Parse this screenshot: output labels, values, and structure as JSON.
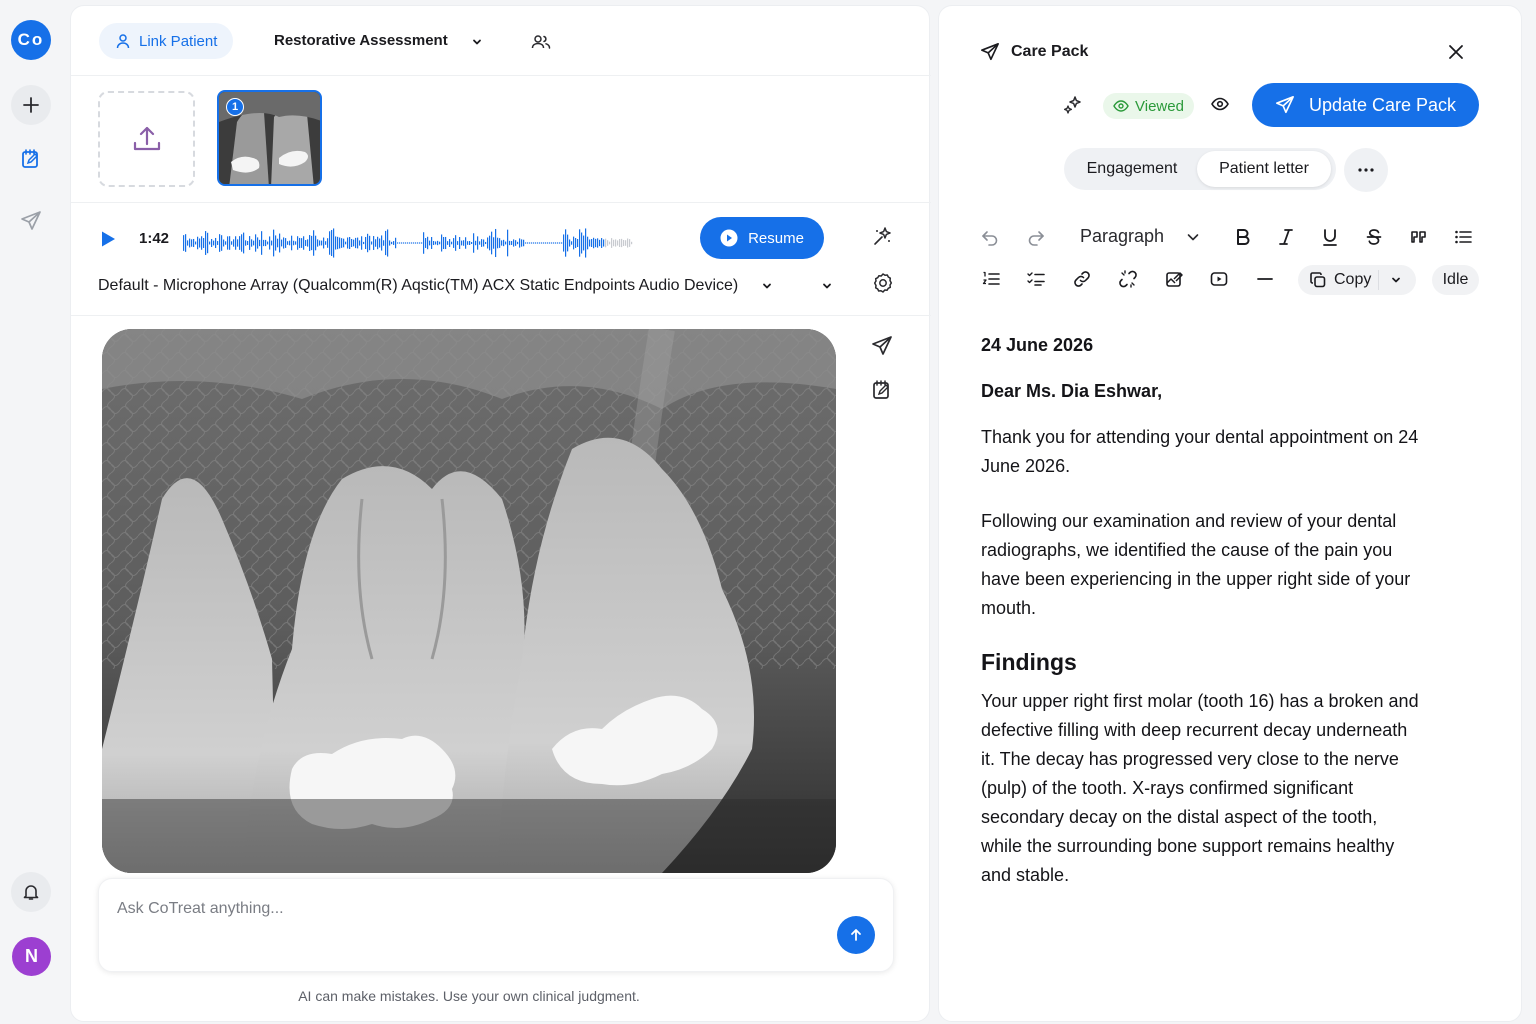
{
  "app": {
    "logo_text": "Co",
    "avatar_initial": "N",
    "accent_color": "#1670e8"
  },
  "header": {
    "link_patient_label": "Link Patient",
    "assessment_label": "Restorative Assessment"
  },
  "images": {
    "thumbnail_badge": "1"
  },
  "recording": {
    "time": "1:42",
    "resume_label": "Resume",
    "device_label": "Default - Microphone Array (Qualcomm(R) Aqstic(TM) ACX Static Endpoints Audio Device)"
  },
  "chat": {
    "placeholder": "Ask CoTreat anything...",
    "disclaimer": "AI can make mistakes. Use your own clinical judgment."
  },
  "care_pack": {
    "title": "Care Pack",
    "status": "Viewed",
    "update_label": "Update Care Pack",
    "tabs": [
      "Engagement",
      "Patient letter"
    ],
    "active_tab": "Patient letter",
    "toolbar": {
      "block_format": "Paragraph",
      "copy_label": "Copy",
      "state_label": "Idle"
    },
    "letter": {
      "date": "24 June 2026",
      "greeting": "Dear Ms. Dia Eshwar,",
      "para1": "Thank you for attending your dental appointment on 24 June 2026.",
      "para2": "Following our examination and review of your dental radiographs, we identified the cause of the pain you have been experiencing in the upper right side of your mouth.",
      "heading": "Findings",
      "para3": "Your upper right first molar (tooth 16) has a broken and defective filling with deep recurrent decay underneath it. The decay has progressed very close to the nerve (pulp) of the tooth. X-rays confirmed significant secondary decay on the distal aspect of the tooth, while the surrounding bone support remains healthy and stable."
    }
  }
}
